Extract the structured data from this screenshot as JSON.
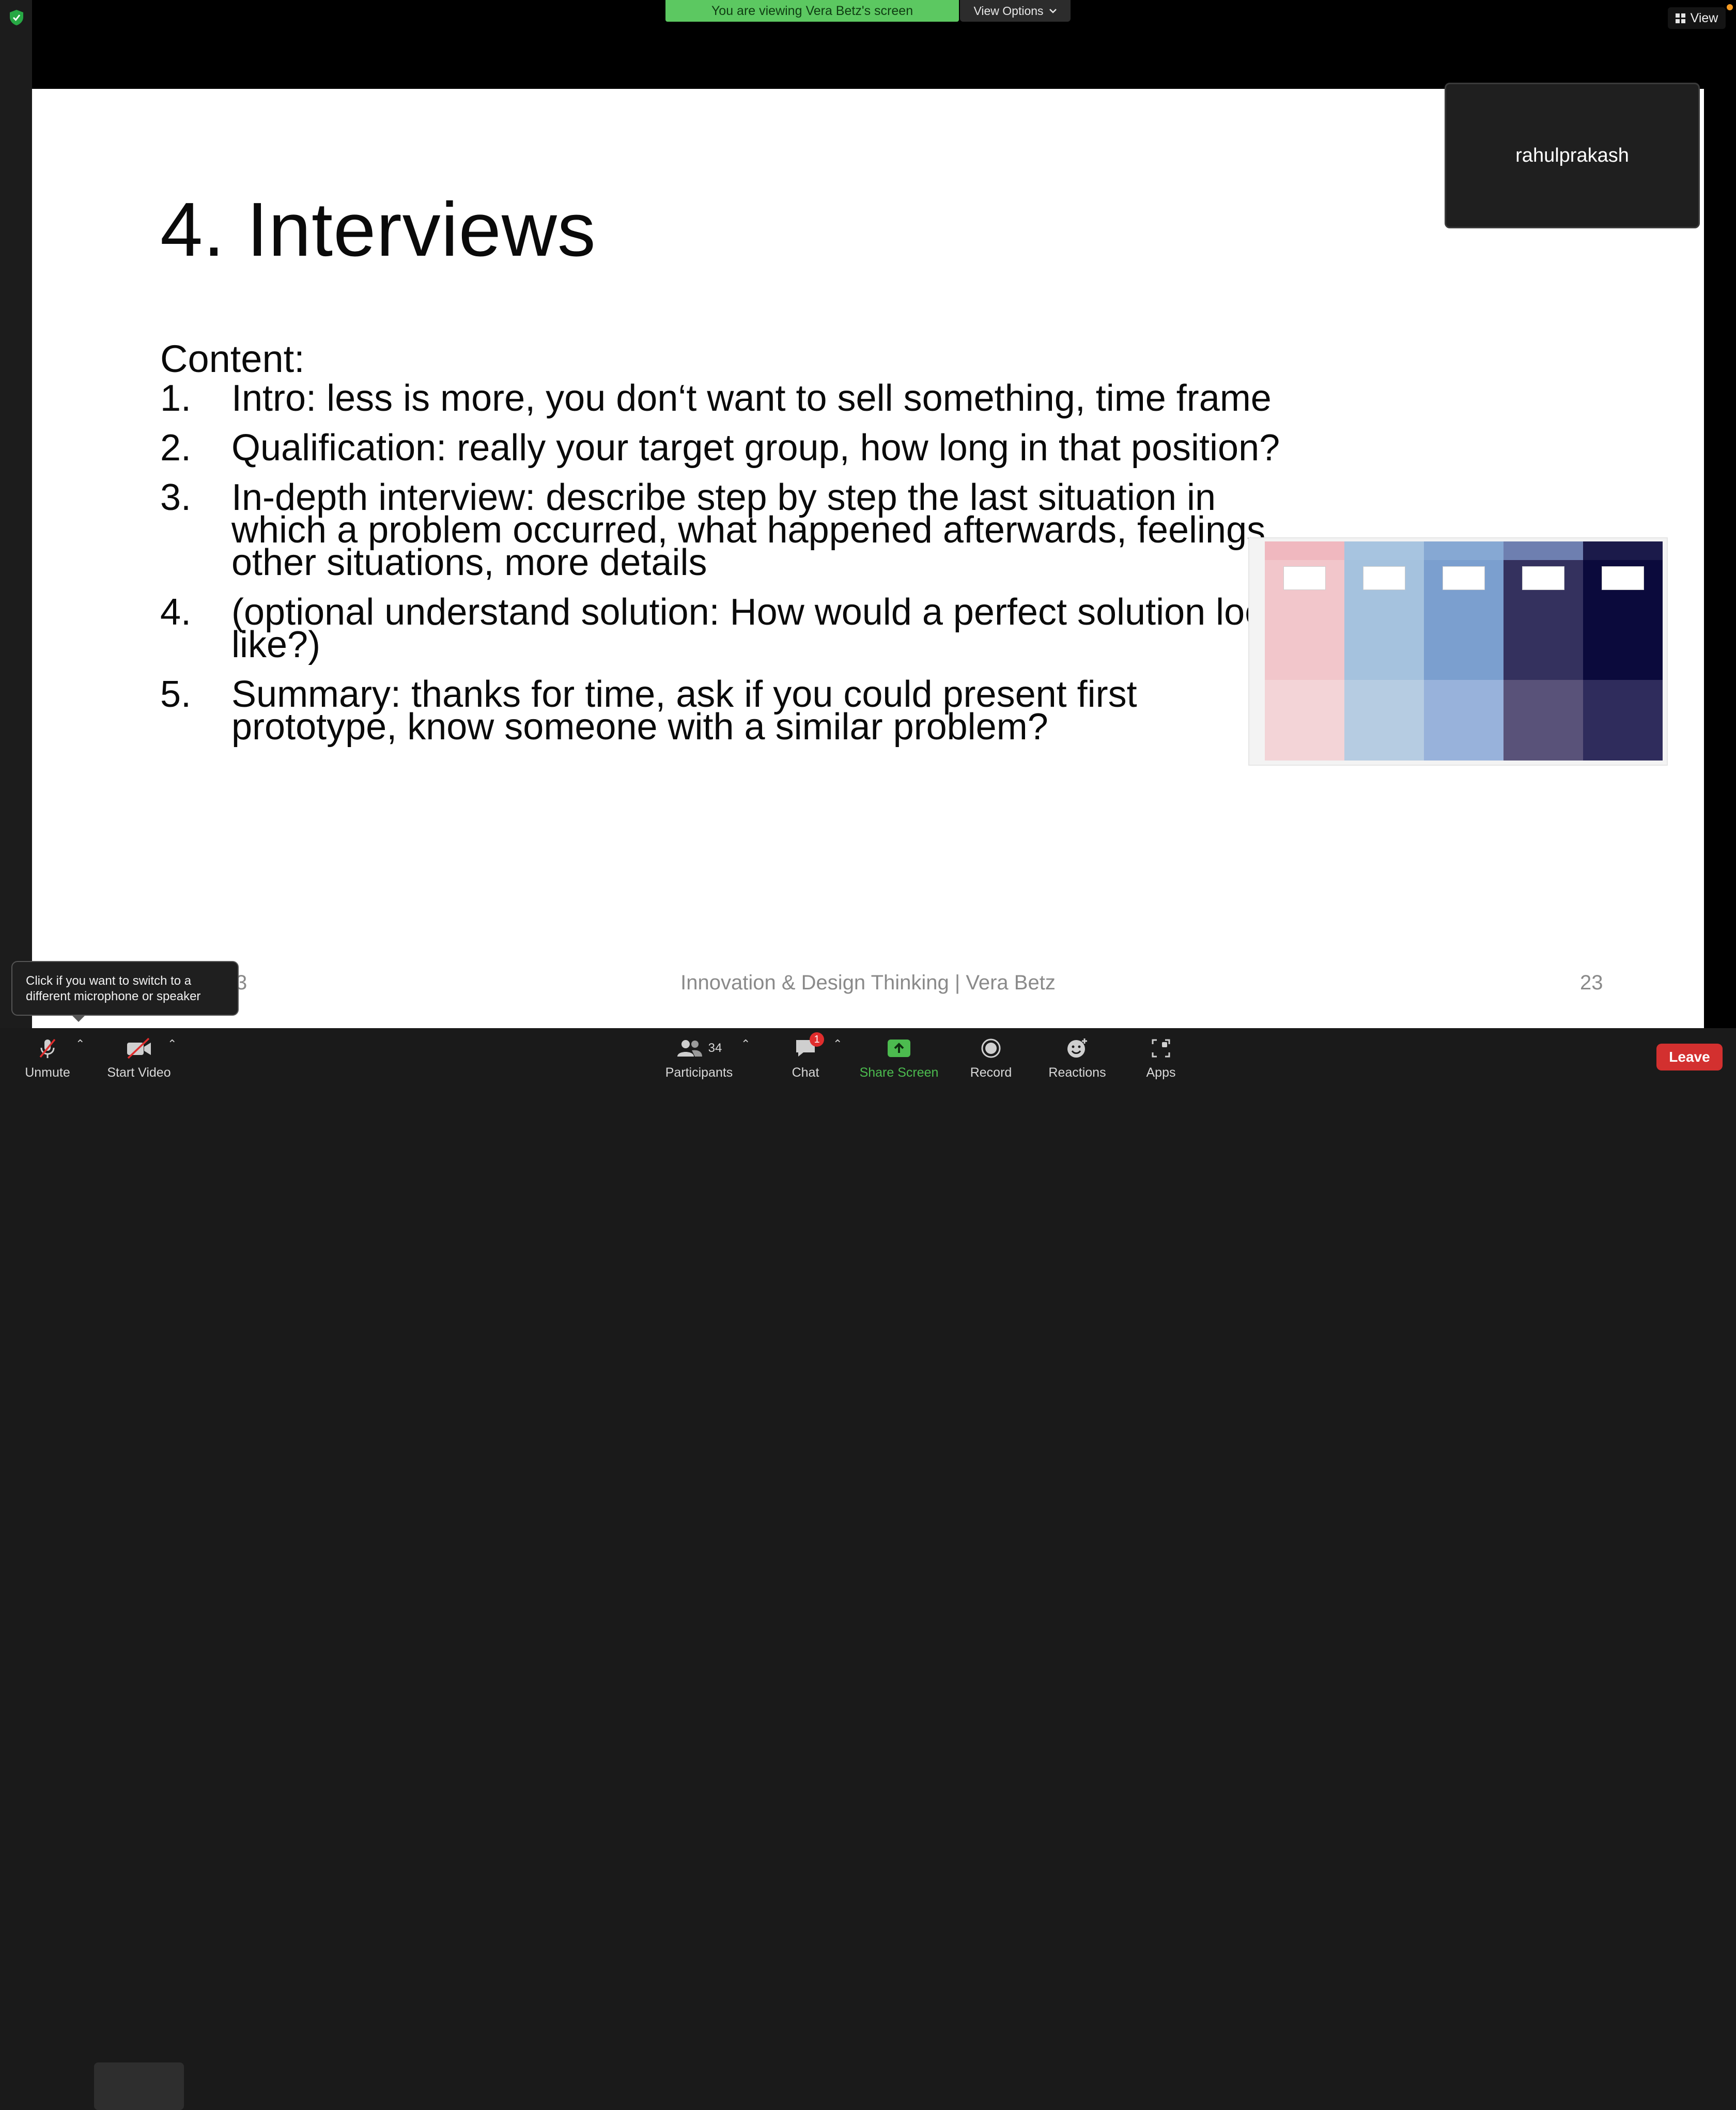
{
  "banner": {
    "text": "You are viewing Vera Betz's screen",
    "view_options": "View Options",
    "view": "View"
  },
  "slide": {
    "title": "4. Interviews",
    "content_heading": "Content:",
    "items": [
      {
        "num": "1.",
        "text": "Intro: less is more, you don‘t want to sell something, time frame"
      },
      {
        "num": "2.",
        "text": "Qualification: really your target group, how long in that position?"
      },
      {
        "num": "3.",
        "text": "In-depth interview: describe step by step the last situation in which a problem occurred, what happened afterwards, feelings, other situations, more details"
      },
      {
        "num": "4.",
        "text": "(optional understand solution: How would a perfect solution look like?)"
      },
      {
        "num": "5.",
        "text": "Summary: thanks for time, ask if you could present first prototype, know someone with a similar problem?"
      }
    ],
    "footer": "Innovation & Design Thinking | Vera Betz",
    "page_number": "23",
    "page_number_partial": "3"
  },
  "participant_tile": {
    "name": "rahulprakash"
  },
  "tooltip": {
    "text": "Click if you want to switch to a different microphone or speaker"
  },
  "toolbar": {
    "unmute": "Unmute",
    "start_video": "Start Video",
    "participants": "Participants",
    "participants_count": "34",
    "chat": "Chat",
    "chat_badge": "1",
    "share_screen": "Share Screen",
    "record": "Record",
    "reactions": "Reactions",
    "apps": "Apps",
    "leave": "Leave"
  },
  "colors": {
    "banner_green": "#5cc861",
    "share_green": "#4cbb4f",
    "leave_red": "#d3302f",
    "thumb_cols_row1": [
      "#f2c6cb",
      "#a5c2de",
      "#7b9fcf",
      "#34315e",
      "#0b0a3c"
    ],
    "thumb_cols_row2": [
      "#f3d4d7",
      "#b6cce2",
      "#98b2db",
      "#595279",
      "#2f2c5c"
    ],
    "thumb_heads": [
      "#f0b8bf",
      "#a7c4e0",
      "#86a8d3",
      "#6e7fb0",
      "#1b1a4a"
    ]
  }
}
